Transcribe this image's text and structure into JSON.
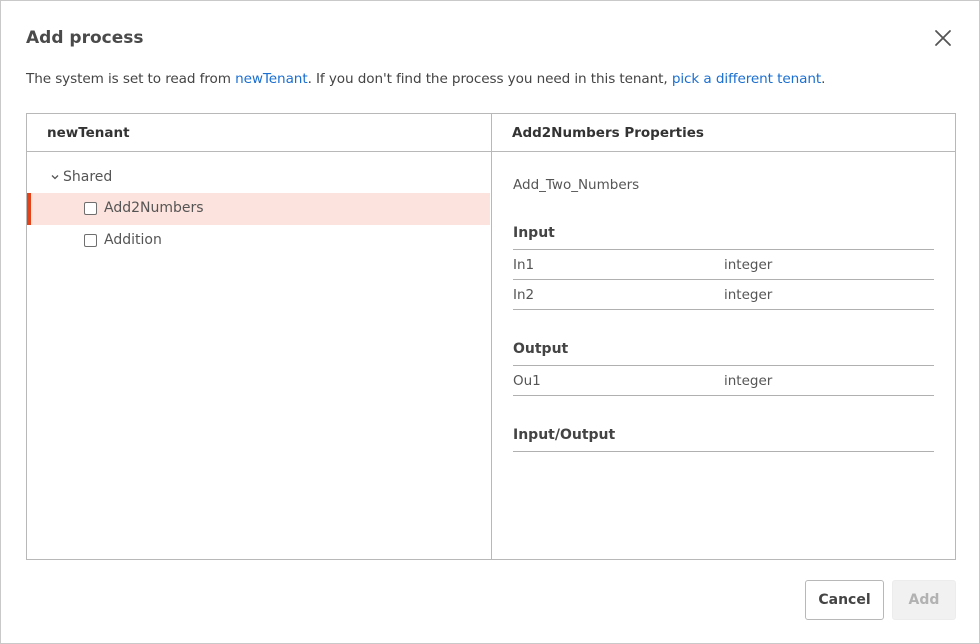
{
  "dialog": {
    "title": "Add process",
    "description": {
      "prefix": "The system is set to read from ",
      "tenant_link": "newTenant",
      "middle": ". If you don't find the process you need in this tenant, ",
      "change_link": "pick a different tenant",
      "suffix": "."
    }
  },
  "tree_pane": {
    "header": "newTenant",
    "folder": "Shared",
    "items": [
      {
        "label": "Add2Numbers",
        "selected": true
      },
      {
        "label": "Addition",
        "selected": false
      }
    ]
  },
  "properties_pane": {
    "header": "Add2Numbers Properties",
    "process_name": "Add_Two_Numbers",
    "sections": [
      {
        "title": "Input",
        "rows": [
          {
            "name": "In1",
            "type": "integer"
          },
          {
            "name": "In2",
            "type": "integer"
          }
        ]
      },
      {
        "title": "Output",
        "rows": [
          {
            "name": "Ou1",
            "type": "integer"
          }
        ]
      },
      {
        "title": "Input/Output",
        "rows": []
      }
    ]
  },
  "footer": {
    "cancel_label": "Cancel",
    "add_label": "Add"
  },
  "colors": {
    "link": "#1a6fd1",
    "selection_bg": "#fde3dd",
    "selection_accent": "#e2431b"
  },
  "icons": {
    "close": "close-icon",
    "folder_toggle": "chevron-down-icon",
    "item_checkbox": "checkbox-icon"
  }
}
